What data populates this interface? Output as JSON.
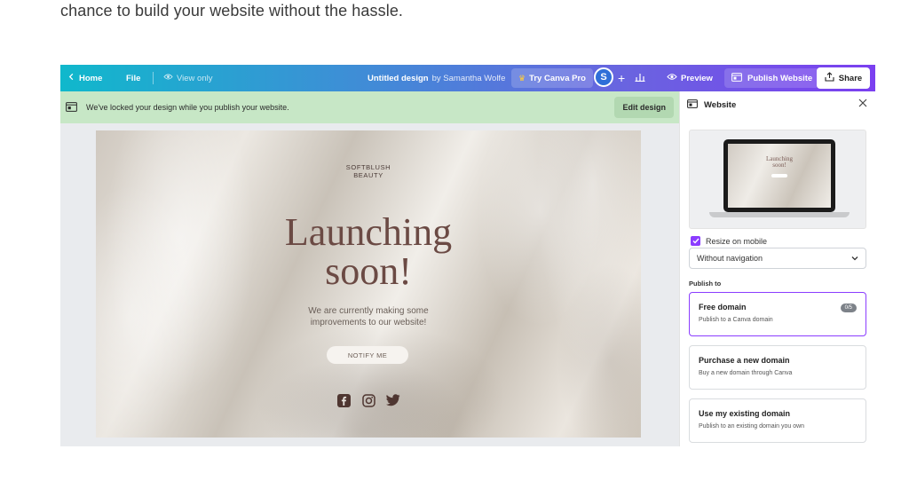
{
  "intro_text": "chance to build your website without the hassle.",
  "topbar": {
    "home": "Home",
    "file": "File",
    "view_only": "View only",
    "title": "Untitled design",
    "title_by": "by Samantha Wolfe",
    "try_pro": "Try Canva Pro",
    "avatar_initial": "S",
    "preview": "Preview",
    "publish": "Publish Website",
    "share": "Share"
  },
  "banner": {
    "text": "We've locked your design while you publish your website.",
    "edit_button": "Edit design"
  },
  "design": {
    "brand_line1": "SOFTBLUSH",
    "brand_line2": "BEAUTY",
    "headline_line1": "Launching",
    "headline_line2": "soon!",
    "sub_line1": "We are currently making some",
    "sub_line2": "improvements to our website!",
    "notify_button": "NOTIFY ME",
    "social_icons": [
      "facebook-icon",
      "instagram-icon",
      "twitter-icon"
    ]
  },
  "panel": {
    "title": "Website",
    "preview_headline_line1": "Launching",
    "preview_headline_line2": "soon!",
    "resize_label": "Resize on mobile",
    "resize_checked": true,
    "navigation_select": "Without navigation",
    "publish_to_label": "Publish to",
    "options": [
      {
        "title": "Free domain",
        "desc": "Publish to a Canva domain",
        "badge": "0/5",
        "selected": true
      },
      {
        "title": "Purchase a new domain",
        "desc": "Buy a new domain through Canva",
        "selected": false
      },
      {
        "title": "Use my existing domain",
        "desc": "Publish to an existing domain you own",
        "selected": false
      }
    ]
  },
  "colors": {
    "accent_purple": "#8b3dff",
    "banner_green": "#c7e7c6",
    "headline_brown": "#6b4a44"
  }
}
